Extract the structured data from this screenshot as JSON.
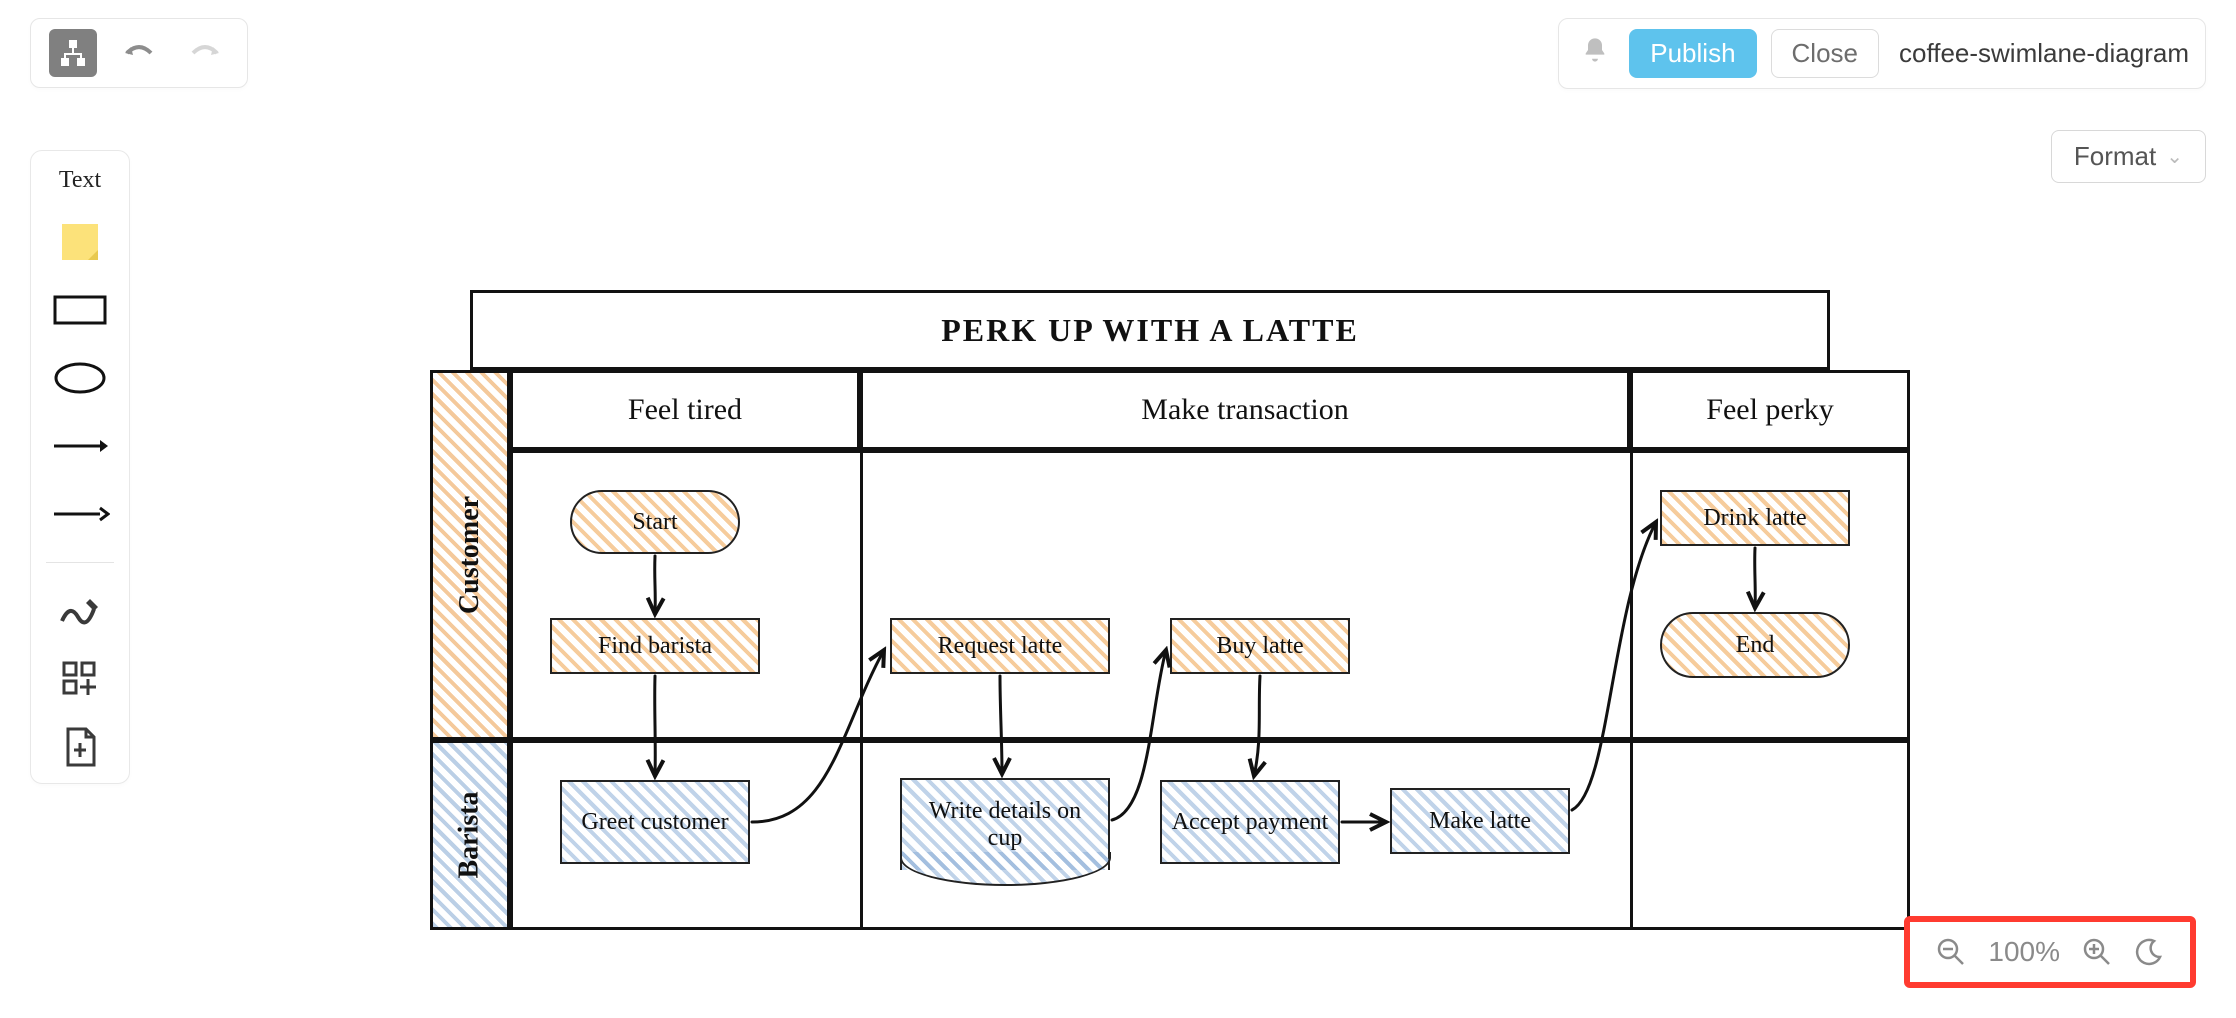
{
  "header": {
    "publish_label": "Publish",
    "close_label": "Close",
    "doc_name": "coffee-swimlane-diagram"
  },
  "format": {
    "label": "Format"
  },
  "palette": {
    "text_label": "Text"
  },
  "zoom": {
    "level": "100%"
  },
  "diagram": {
    "title": "PERK UP WITH A LATTE",
    "lanes": {
      "customer": "Customer",
      "barista": "Barista"
    },
    "phases": {
      "p1": "Feel tired",
      "p2": "Make transaction",
      "p3": "Feel perky"
    },
    "nodes": {
      "start": "Start",
      "find_barista": "Find barista",
      "greet_customer": "Greet customer",
      "request_latte": "Request latte",
      "write_details": "Write details on cup",
      "buy_latte": "Buy latte",
      "accept_payment": "Accept payment",
      "make_latte": "Make latte",
      "drink_latte": "Drink latte",
      "end": "End"
    }
  },
  "chart_data": {
    "type": "swimlane",
    "title": "PERK UP WITH A LATTE",
    "lanes": [
      "Customer",
      "Barista"
    ],
    "phases": [
      "Feel tired",
      "Make transaction",
      "Feel perky"
    ],
    "nodes": [
      {
        "id": "start",
        "lane": "Customer",
        "phase": "Feel tired",
        "label": "Start",
        "shape": "terminator"
      },
      {
        "id": "find",
        "lane": "Customer",
        "phase": "Feel tired",
        "label": "Find barista",
        "shape": "process"
      },
      {
        "id": "greet",
        "lane": "Barista",
        "phase": "Feel tired",
        "label": "Greet customer",
        "shape": "process"
      },
      {
        "id": "request",
        "lane": "Customer",
        "phase": "Make transaction",
        "label": "Request latte",
        "shape": "process"
      },
      {
        "id": "write",
        "lane": "Barista",
        "phase": "Make transaction",
        "label": "Write details on cup",
        "shape": "document"
      },
      {
        "id": "buy",
        "lane": "Customer",
        "phase": "Make transaction",
        "label": "Buy latte",
        "shape": "process"
      },
      {
        "id": "accept",
        "lane": "Barista",
        "phase": "Make transaction",
        "label": "Accept payment",
        "shape": "process"
      },
      {
        "id": "make",
        "lane": "Barista",
        "phase": "Make transaction",
        "label": "Make latte",
        "shape": "process"
      },
      {
        "id": "drink",
        "lane": "Customer",
        "phase": "Feel perky",
        "label": "Drink latte",
        "shape": "process"
      },
      {
        "id": "end",
        "lane": "Customer",
        "phase": "Feel perky",
        "label": "End",
        "shape": "terminator"
      }
    ],
    "edges": [
      [
        "start",
        "find"
      ],
      [
        "find",
        "greet"
      ],
      [
        "greet",
        "request"
      ],
      [
        "request",
        "write"
      ],
      [
        "write",
        "buy"
      ],
      [
        "buy",
        "accept"
      ],
      [
        "accept",
        "make"
      ],
      [
        "make",
        "drink"
      ],
      [
        "drink",
        "end"
      ]
    ]
  }
}
